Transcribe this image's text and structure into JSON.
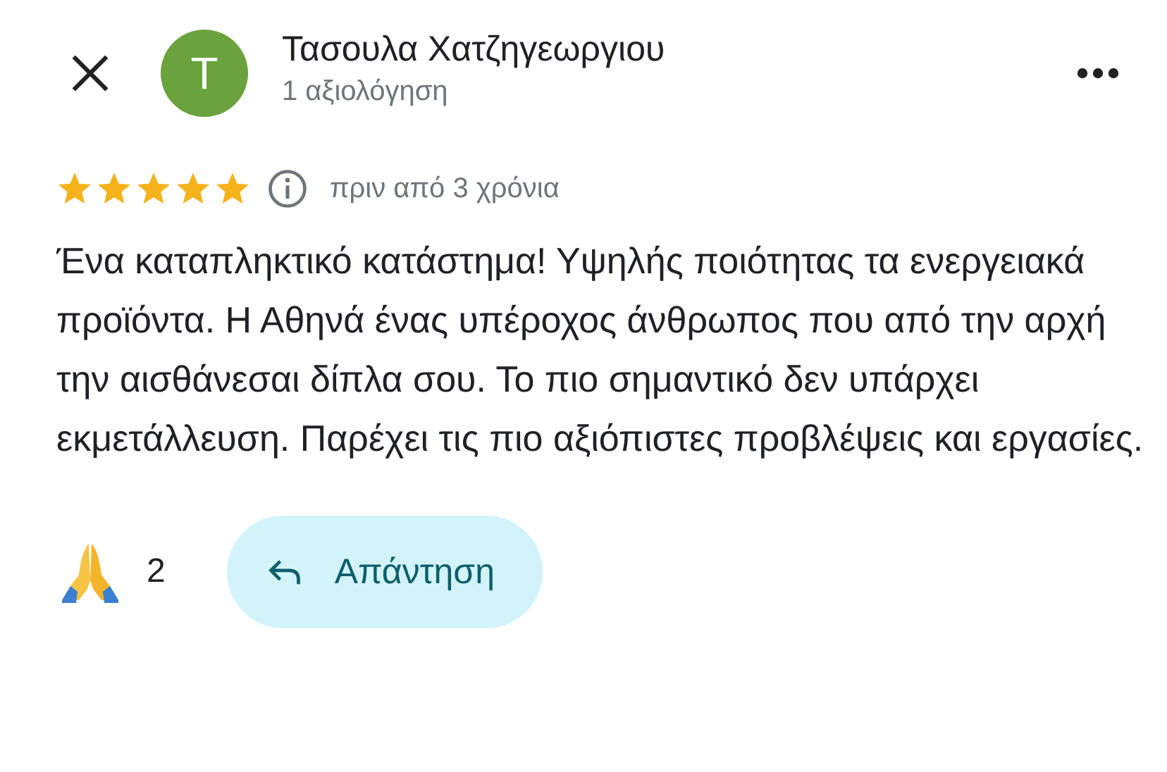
{
  "reviewer": {
    "avatar_letter": "T",
    "color": "#6aa23e",
    "name": "Τασουλα Χατζηγεωργιου",
    "review_count": "1 αξιολόγηση"
  },
  "review": {
    "stars": 5,
    "time": "πριν από 3 χρόνια",
    "text": "Ένα καταπληκτικό κατάστημα! Υψηλής ποιότητας τα ενεργειακά προϊόντα. Η Αθηνά ένας υπέροχος άνθρωπος που από την αρχή την αισθάνεσαι δίπλα σου. Το πιο σημαντικό δεν υπάρχει εκμετάλλευση. Παρέχει τις πιο αξιόπιστες προβλέψεις και εργασίες."
  },
  "reaction": {
    "count": "2"
  },
  "reply_button": {
    "label": "Απάντηση"
  }
}
